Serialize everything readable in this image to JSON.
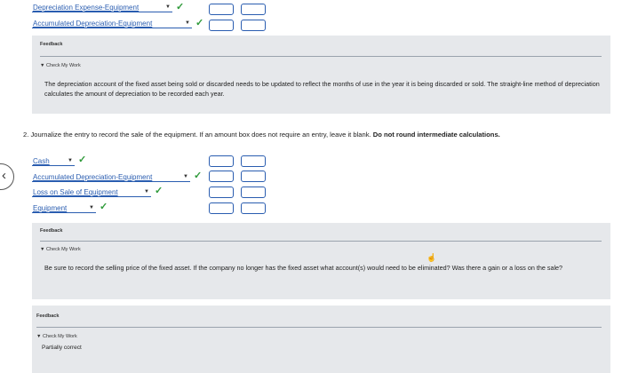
{
  "top_entry": {
    "rows": [
      {
        "account": "Depreciation Expense-Equipment"
      },
      {
        "account": "Accumulated Depreciation-Equipment"
      }
    ]
  },
  "feedback1": {
    "title": "Feedback",
    "check_label": "Check My Work",
    "text": "The depreciation account of the fixed asset being sold or discarded needs to be updated to reflect the months of use in the year it is being discarded or sold. The straight-line method of depreciation calculates the amount of depreciation to be recorded each year."
  },
  "question2": {
    "number": "2.",
    "text": "Journalize the entry to record the sale of the equipment. If an amount box does not require an entry, leave it blank.",
    "bold": "Do not round intermediate calculations."
  },
  "entry2": {
    "rows": [
      {
        "account": "Cash"
      },
      {
        "account": "Accumulated Depreciation-Equipment"
      },
      {
        "account": "Loss on Sale of Equipment"
      },
      {
        "account": "Equipment"
      }
    ]
  },
  "feedback2": {
    "title": "Feedback",
    "check_label": "Check My Work",
    "text": "Be sure to record the selling price of the fixed asset. If the company no longer has the fixed asset what account(s) would need to be eliminated? Was there a gain or a loss on the sale?"
  },
  "feedback3": {
    "title": "Feedback",
    "check_label": "Check My Work",
    "status": "Partially correct"
  },
  "icons": {
    "check": "checkmark-icon",
    "caret": "caret-down-icon",
    "back": "chevron-left-icon",
    "cursor": "hand-cursor-icon"
  },
  "colors": {
    "check": "#2f9a3a",
    "link": "#2a5db0",
    "panel": "#e6e8eb"
  }
}
